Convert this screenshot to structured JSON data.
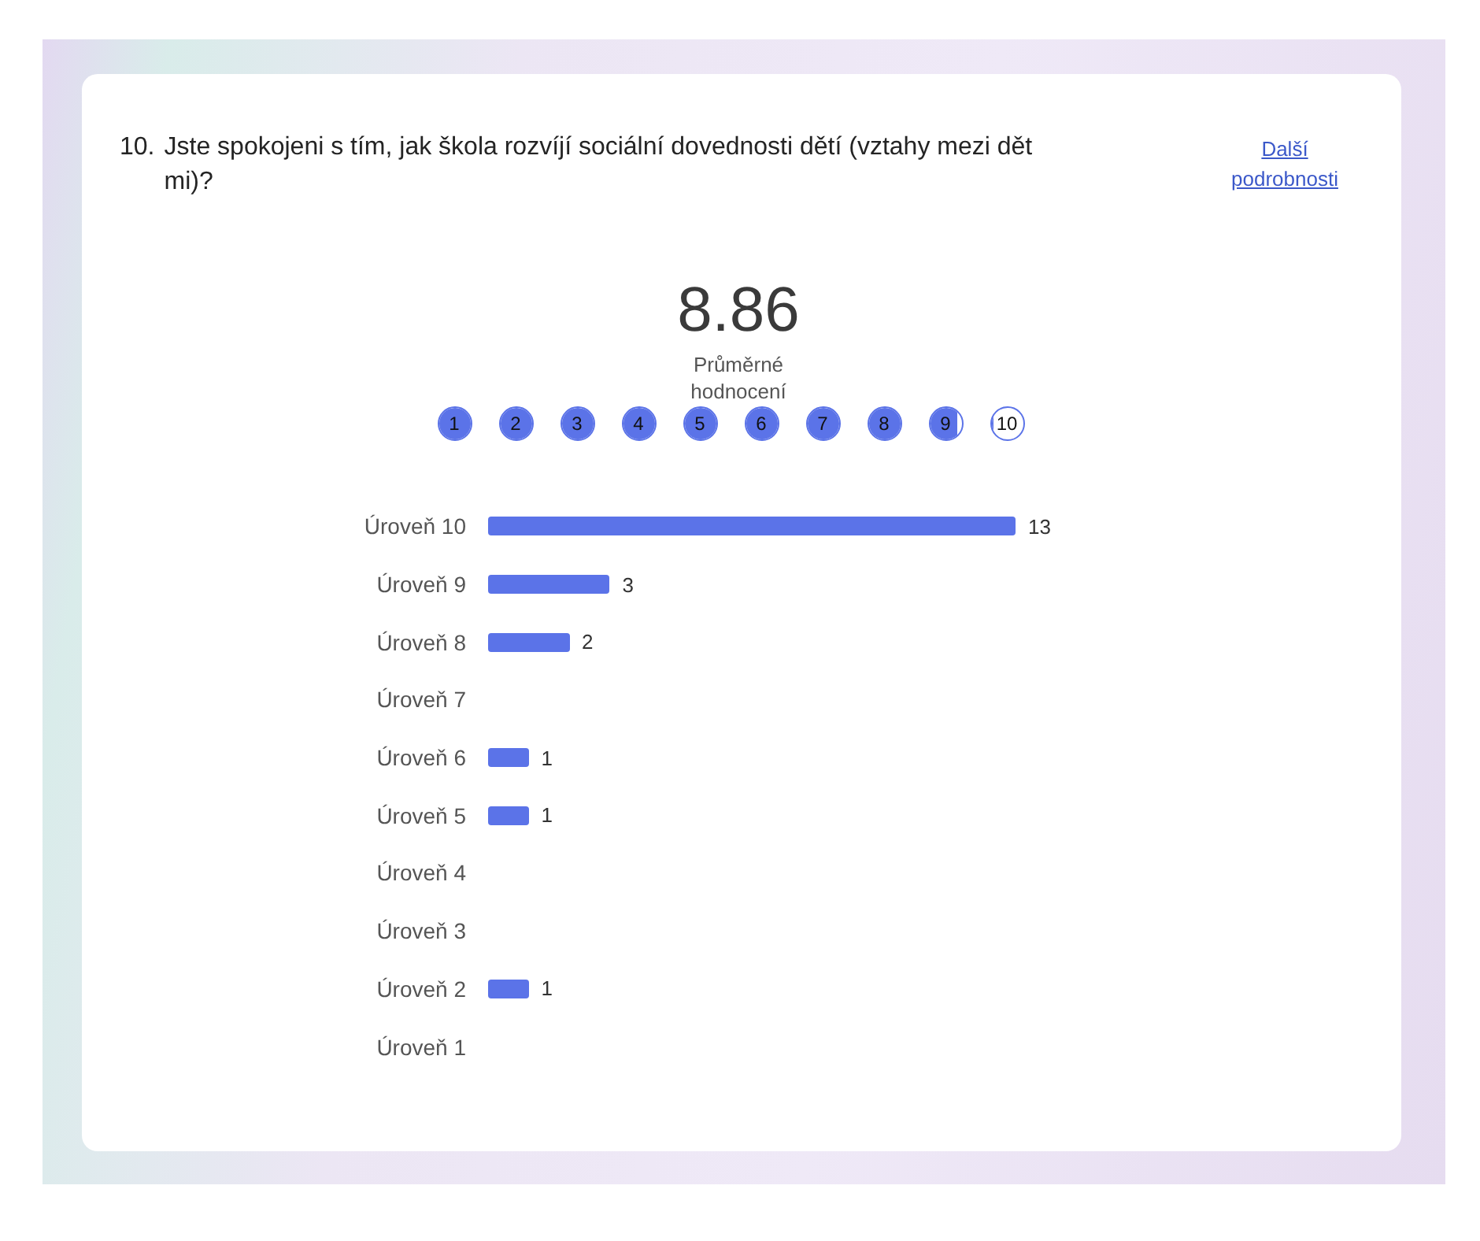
{
  "question": {
    "number": "10.",
    "text": "Jste spokojeni s tím, jak škola rozvíjí sociální dovednosti dětí (vztahy mezi dětmi)?",
    "details_link": "Další podrobnosti"
  },
  "average": {
    "value": "8.86",
    "label": "Průměrné hodnocení"
  },
  "rating_circles": [
    {
      "label": "1",
      "level": 1
    },
    {
      "label": "2",
      "level": 1
    },
    {
      "label": "3",
      "level": 1
    },
    {
      "label": "4",
      "level": 1
    },
    {
      "label": "5",
      "level": 1
    },
    {
      "label": "6",
      "level": 1
    },
    {
      "label": "7",
      "level": 1
    },
    {
      "label": "8",
      "level": 1
    },
    {
      "label": "9",
      "level": 0.86
    },
    {
      "label": "10",
      "level": 0
    }
  ],
  "chart_data": {
    "type": "bar",
    "orientation": "horizontal",
    "data_labels": true,
    "categories": [
      "Úroveň 10",
      "Úroveň 9",
      "Úroveň 8",
      "Úroveň 7",
      "Úroveň 6",
      "Úroveň 5",
      "Úroveň 4",
      "Úroveň 3",
      "Úroveň 2",
      "Úroveň 1"
    ],
    "series": [
      {
        "color": "#5b73e8",
        "values": [
          13,
          3,
          2,
          null,
          1,
          1,
          null,
          null,
          1,
          null
        ]
      }
    ]
  }
}
